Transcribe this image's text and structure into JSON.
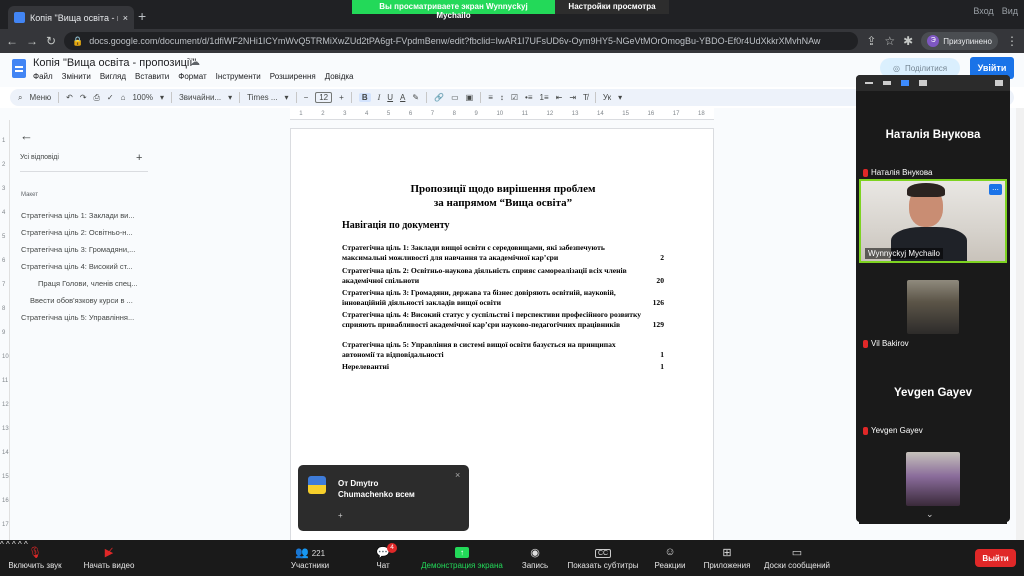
{
  "browser": {
    "tab_title": "Копія \"Вища освіта - пропозиції\"",
    "new_tab": "+",
    "url": "docs.google.com/document/d/1dfiWF2NHi1ICYmWvQ5TRMiXwZUd2tPA6gt-FVpdmBenw/edit?fbclid=IwAR1I7UFsUD6v-Oym9HY5-NGeVtMOrOmogBu-YBDO-Ef0r4UdXkkrXMvhNAw",
    "profile_letter": "Э",
    "profile_label": "Призупинено",
    "window_controls": [
      "Вход",
      "Вид"
    ]
  },
  "zoom_share_banner": {
    "viewing_text": "Вы просматриваете экран Wynnyckyj Mychailo",
    "view_settings": "Настройки просмотра"
  },
  "docs": {
    "title": "Копія \"Вища освіта - пропозиції\"",
    "menu": [
      "Файл",
      "Змінити",
      "Вигляд",
      "Вставити",
      "Формат",
      "Інструменти",
      "Розширення",
      "Довідка"
    ],
    "share_label": "Поділитися",
    "join_label": "Увійти",
    "toolbar": {
      "menus": "Меню",
      "zoom": "100%",
      "style": "Звичайни...",
      "font": "Times ...",
      "font_size": "12",
      "bold": "B",
      "italic": "I",
      "underline": "U",
      "text_color": "A",
      "input_tools": "Ук"
    }
  },
  "outline": {
    "all_replies": "Усі відповіді",
    "section": "Макет",
    "items": [
      "Стратегічна ціль 1: Заклади ви...",
      "Стратегічна ціль 2: Освітньо-н...",
      "Стратегічна ціль 3: Громадяни,...",
      "Стратегічна ціль 4: Високий ст...",
      "Праця Голови, членів спец...",
      "Ввести обов'язкову курси в ...",
      "Стратегічна ціль 5: Управління..."
    ]
  },
  "document": {
    "title_line1": "Пропозиції щодо вирішення проблем",
    "title_line2": "за напрямом “Вища освіта”",
    "nav_heading": "Навігація по документу",
    "toc": [
      {
        "text": "Стратегічна ціль 1: Заклади вищої освіти є середовищами, які забезпечують максимальні можливості для навчання та академічної кар’єри",
        "page": "2"
      },
      {
        "text": "Стратегічна ціль 2: Освітньо-наукова діяльність сприяє самореалізації всіх членів академічної спільноти",
        "page": "20"
      },
      {
        "text": "Стратегічна ціль 3: Громадяни, держава та бізнес довіряють освітній, науковій, інноваційній діяльності закладів вищої освіти",
        "page": "126"
      },
      {
        "text": "Стратегічна ціль 4: Високий статус у суспільстві і перспективи професійного розвитку сприяють привабливості академічної кар’єри науково-педагогічних працівників",
        "page": "129"
      },
      {
        "text": "Стратегічна ціль 5: Управління в системі вищої освіти базується на принципах автономії та відповідальності",
        "page": "1"
      },
      {
        "text": "Нерелевантні",
        "page": "1"
      }
    ]
  },
  "vertical_ruler": [
    "1",
    "2",
    "3",
    "4",
    "5",
    "6",
    "7",
    "8",
    "9",
    "10",
    "11",
    "12",
    "13",
    "14",
    "15",
    "16",
    "17"
  ],
  "horizontal_ruler": [
    "1",
    "2",
    "3",
    "4",
    "5",
    "6",
    "7",
    "8",
    "9",
    "10",
    "11",
    "12",
    "13",
    "14",
    "15",
    "16",
    "17",
    "18"
  ],
  "participants_panel": {
    "tiles": [
      {
        "name": "Наталія Внукова",
        "display": "Наталія Внукова"
      },
      {
        "name": "Wynnyckyj Mychailo"
      },
      {
        "name": "Vil Bakirov"
      },
      {
        "name": "Yevgen Gayev",
        "display": "Yevgen Gayev"
      },
      {
        "name": ""
      }
    ],
    "more": "...",
    "chevron": "⌄"
  },
  "chat_toast": {
    "from_line1": "От Dmytro",
    "from_line2": "Chumachenko всем",
    "close": "×",
    "plus": "+"
  },
  "zoom_toolbar": {
    "mute": "Включить звук",
    "video": "Начать видео",
    "participants_count": "221",
    "participants": "Участники",
    "chat_count": "4",
    "chat": "Чат",
    "share": "Демонстрация экрана",
    "record": "Запись",
    "cc_icon": "CC",
    "subtitles": "Показать субтитры",
    "reactions": "Реакции",
    "apps": "Приложения",
    "whiteboards": "Доски сообщений",
    "leave": "Выйти"
  },
  "colors": {
    "zoom_green": "#23d959",
    "zoom_red": "#e02828",
    "docs_blue": "#1a73e8",
    "active_speaker_border": "#7ed321"
  }
}
